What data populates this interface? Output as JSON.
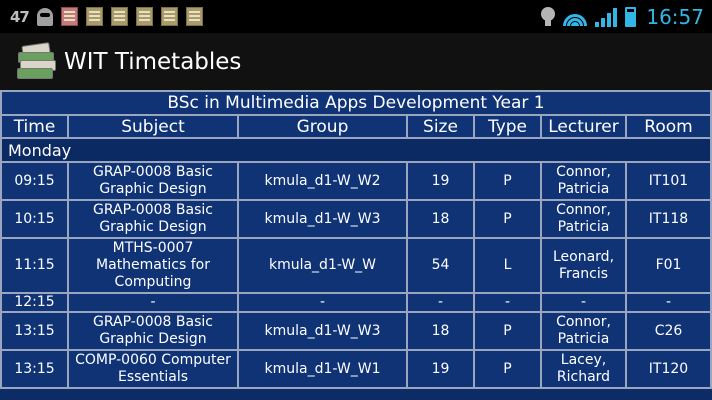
{
  "status_bar": {
    "notification_count": "47",
    "time": "16:57",
    "colors": {
      "accent": "#33b5e5"
    },
    "icons": [
      "snapchat-ghost-icon",
      "calendar-icon",
      "notes-icon",
      "notes-icon",
      "notes-icon",
      "notes-icon",
      "notes-icon",
      "bulb-icon",
      "wifi-icon",
      "signal-icon",
      "battery-icon"
    ]
  },
  "action_bar": {
    "title": "WIT Timetables",
    "icon": "books-stack-icon"
  },
  "timetable": {
    "course_title": "BSc in Multimedia Apps Development Year 1",
    "columns": [
      "Time",
      "Subject",
      "Group",
      "Size",
      "Type",
      "Lecturer",
      "Room"
    ],
    "day": "Monday",
    "rows": [
      {
        "time": "09:15",
        "subject": "GRAP-0008 Basic Graphic Design",
        "group": "kmula_d1-W_W2",
        "size": "19",
        "type": "P",
        "lecturer": "Connor, Patricia",
        "room": "IT101"
      },
      {
        "time": "10:15",
        "subject": "GRAP-0008 Basic Graphic Design",
        "group": "kmula_d1-W_W3",
        "size": "18",
        "type": "P",
        "lecturer": "Connor, Patricia",
        "room": "IT118"
      },
      {
        "time": "11:15",
        "subject": "MTHS-0007 Mathematics for Computing",
        "group": "kmula_d1-W_W",
        "size": "54",
        "type": "L",
        "lecturer": "Leonard, Francis",
        "room": "F01"
      },
      {
        "time": "12:15",
        "subject": "-",
        "group": "-",
        "size": "-",
        "type": "-",
        "lecturer": "-",
        "room": "-"
      },
      {
        "time": "13:15",
        "subject": "GRAP-0008 Basic Graphic Design",
        "group": "kmula_d1-W_W3",
        "size": "18",
        "type": "P",
        "lecturer": "Connor, Patricia",
        "room": "C26"
      },
      {
        "time": "13:15",
        "subject": "COMP-0060 Computer Essentials",
        "group": "kmula_d1-W_W1",
        "size": "19",
        "type": "P",
        "lecturer": "Lacey, Richard",
        "room": "IT120"
      }
    ],
    "colors": {
      "cell_bg": "#0f3375",
      "grid": "#9aa6c0",
      "background": "#0d2c66"
    }
  }
}
